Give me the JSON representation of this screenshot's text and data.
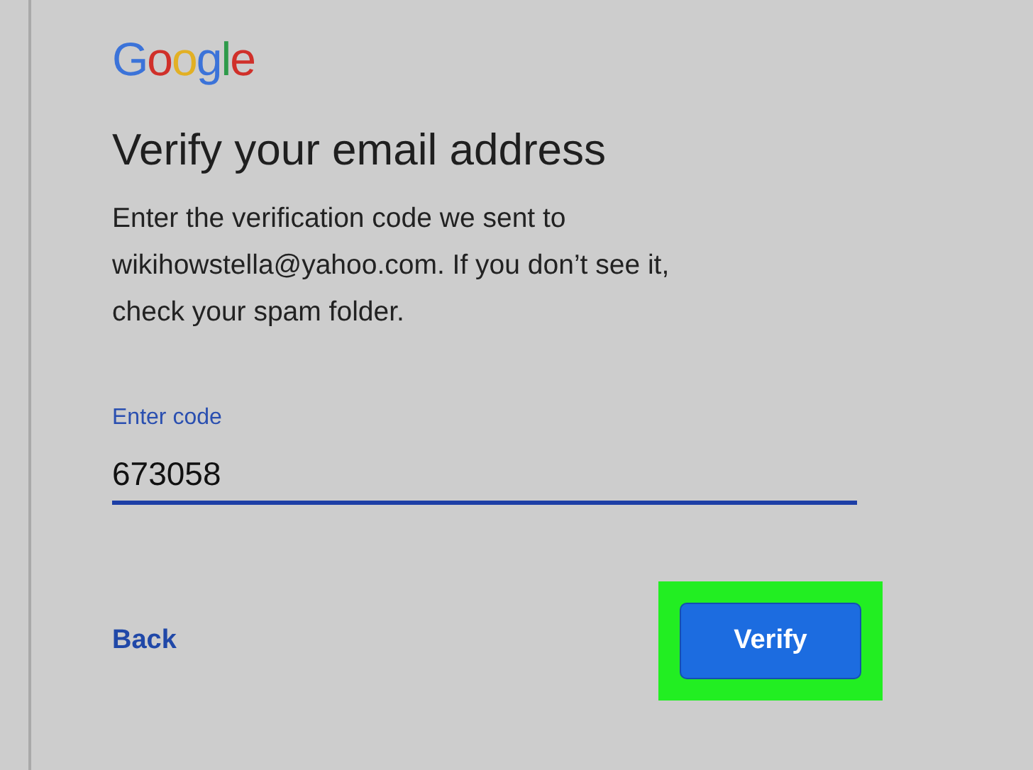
{
  "logo": {
    "letters": [
      {
        "text": "G",
        "color": "#3b73d9"
      },
      {
        "text": "o",
        "color": "#d0302a"
      },
      {
        "text": "o",
        "color": "#e2b024"
      },
      {
        "text": "g",
        "color": "#3b73d9"
      },
      {
        "text": "l",
        "color": "#2e9a4a"
      },
      {
        "text": "e",
        "color": "#d0302a"
      }
    ]
  },
  "heading": "Verify your email address",
  "description": "Enter the verification code we sent to wikihowstella@yahoo.com. If you don’t see it, check your spam folder.",
  "code_field": {
    "label": "Enter code",
    "value": "673058",
    "focused": true
  },
  "back_link": "Back",
  "verify_button": {
    "label": "Verify",
    "highlighted": true
  }
}
